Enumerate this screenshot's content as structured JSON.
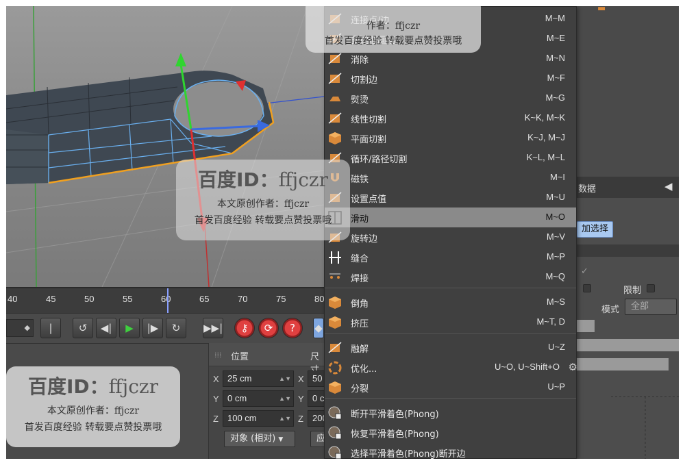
{
  "menu": {
    "items": [
      {
        "label": "连接点/边",
        "shortcut": "M~M",
        "icon": "connect-points-icon",
        "color": "#d9893a"
      },
      {
        "label": "多边形画笔",
        "shortcut": "M~E",
        "icon": "polygon-pen-icon",
        "color": "#d9893a"
      },
      {
        "label": "消除",
        "shortcut": "M~N",
        "icon": "dissolve-icon",
        "color": "#d9893a"
      },
      {
        "label": "切割边",
        "shortcut": "M~F",
        "icon": "edge-cut-icon",
        "color": "#d9893a"
      },
      {
        "label": "熨烫",
        "shortcut": "M~G",
        "icon": "iron-icon",
        "color": "#d9893a"
      },
      {
        "label": "线性切割",
        "shortcut": "K~K, M~K",
        "icon": "line-cut-icon",
        "color": "#d9893a"
      },
      {
        "label": "平面切割",
        "shortcut": "K~J, M~J",
        "icon": "plane-cut-icon",
        "color": "#d9893a"
      },
      {
        "label": "循环/路径切割",
        "shortcut": "K~L, M~L",
        "icon": "loop-cut-icon",
        "color": "#d9893a"
      },
      {
        "label": "磁铁",
        "shortcut": "M~I",
        "icon": "magnet-icon",
        "color": "#d9893a"
      },
      {
        "label": "设置点值",
        "shortcut": "M~U",
        "icon": "set-point-value-icon",
        "color": "#d9893a"
      },
      {
        "label": "滑动",
        "shortcut": "M~O",
        "icon": "slide-icon",
        "color": "#d9893a"
      },
      {
        "label": "旋转边",
        "shortcut": "M~V",
        "icon": "spin-edge-icon",
        "color": "#d9893a"
      },
      {
        "label": "缝合",
        "shortcut": "M~P",
        "icon": "stitch-icon",
        "color": "#ffffff"
      },
      {
        "label": "焊接",
        "shortcut": "M~Q",
        "icon": "weld-icon",
        "color": "#d9893a"
      },
      {
        "label": "倒角",
        "shortcut": "M~S",
        "icon": "bevel-icon",
        "color": "#d9893a"
      },
      {
        "label": "挤压",
        "shortcut": "M~T, D",
        "icon": "extrude-icon",
        "color": "#d9893a"
      },
      {
        "label": "融解",
        "shortcut": "U~Z",
        "icon": "melt-icon",
        "color": "#d9893a"
      },
      {
        "label": "优化...",
        "shortcut": "U~O, U~Shift+O",
        "icon": "optimize-icon",
        "color": "#d9893a"
      },
      {
        "label": "分裂",
        "shortcut": "U~P",
        "icon": "split-icon",
        "color": "#d9893a"
      },
      {
        "label": "断开平滑着色(Phong)",
        "shortcut": "",
        "icon": "break-phong-icon",
        "color": "#b0b0b0"
      },
      {
        "label": "恢复平滑着色(Phong)",
        "shortcut": "",
        "icon": "unbreak-phong-icon",
        "color": "#b0b0b0"
      },
      {
        "label": "选择平滑着色(Phong)断开边",
        "shortcut": "",
        "icon": "select-phong-edges-icon",
        "color": "#b0b0b0"
      }
    ],
    "highlighted_index": 10,
    "gear_icon": "gear-icon"
  },
  "timeline": {
    "ticks": [
      "40",
      "45",
      "50",
      "55",
      "60",
      "65",
      "70",
      "75",
      "80"
    ]
  },
  "transport": {
    "buttons": [
      {
        "glyph": "|◀◀",
        "icon": "go-to-start-icon"
      },
      {
        "glyph": "↺",
        "icon": "previous-keyframe-icon"
      },
      {
        "glyph": "◀|",
        "icon": "previous-frame-icon"
      },
      {
        "glyph": "▶",
        "icon": "play-icon"
      },
      {
        "glyph": "|▶",
        "icon": "next-frame-icon"
      },
      {
        "glyph": "↻",
        "icon": "next-keyframe-icon"
      },
      {
        "glyph": "▶▶|",
        "icon": "go-to-end-icon"
      },
      {
        "glyph": "🔑",
        "icon": "record-key-icon"
      },
      {
        "glyph": "⟳",
        "icon": "auto-key-icon"
      },
      {
        "glyph": "?",
        "icon": "help-icon"
      }
    ]
  },
  "coords": {
    "position_header": "位置",
    "size_header": "尺寸",
    "axes": [
      "X",
      "Y",
      "Z"
    ],
    "position_values": [
      "25 cm",
      "0 cm",
      "100 cm"
    ],
    "size_values": [
      "50",
      "0 c",
      "200"
    ],
    "mode_dropdown": "对象 (相对)",
    "apply_partial": "应"
  },
  "attributes": {
    "header_partial": "数据",
    "blue_button": "加选择",
    "limit_label": "限制",
    "mode_label": "模式",
    "mode_value": "全部"
  },
  "watermarks": {
    "title_cn": "百度ID：",
    "title_id": "ffjczr",
    "line1": "本文原创作者：ffjczr",
    "line2": "首发百度经验 转载要点赞投票哦",
    "top_line1": "作者：ffjczr",
    "top_line2": "首发百度经验 转载要点赞投票哦"
  },
  "colors": {
    "highlight": "#8a8a8a",
    "selection_orange": "#f0a020",
    "edge_blue": "#6ab0f0"
  }
}
